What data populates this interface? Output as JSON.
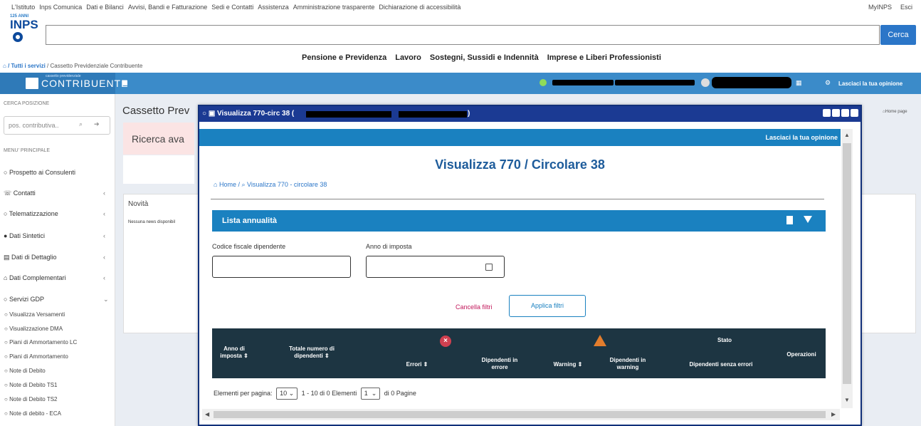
{
  "topnav": {
    "links": [
      "L'Istituto",
      "Inps Comunica",
      "Dati e Bilanci",
      "Avvisi, Bandi e Fatturazione",
      "Sedi e Contatti",
      "Assistenza",
      "Amministrazione trasparente",
      "Dichiarazione di accessibilità"
    ],
    "myinps": "MyINPS",
    "esci": "Esci"
  },
  "logo": {
    "years": "125 ANNI",
    "text": "INPS"
  },
  "search": {
    "button": "Cerca",
    "value": ""
  },
  "mainmenu": [
    "Pensione e Previdenza",
    "Lavoro",
    "Sostegni, Sussidi e Indennità",
    "Imprese e Liberi Professionisti"
  ],
  "breadcrumb": {
    "home": "/ Tutti i servizi",
    "current": "/ Cassetto Previdenziale Contribuente"
  },
  "header": {
    "brand_small": "cassetto previdenziale",
    "brand": "CONTRIBUENTE",
    "opinion": "Lasciaci la tua opinione"
  },
  "sidebar": {
    "cerca_caption": "CERCA POSIZIONE",
    "pos_placeholder": "pos. contributiva..",
    "menu_caption": "MENU' PRINCIPALE",
    "items": [
      {
        "label": "Prospetto ai Consulenti",
        "chevron": ""
      },
      {
        "label": "Contatti",
        "chevron": "‹"
      },
      {
        "label": "Telematizzazione",
        "chevron": "‹"
      },
      {
        "label": "Dati Sintetici",
        "chevron": "‹"
      },
      {
        "label": "Dati di Dettaglio",
        "chevron": "‹"
      },
      {
        "label": "Dati Complementari",
        "chevron": "‹"
      },
      {
        "label": "Servizi GDP",
        "chevron": "⌄"
      }
    ],
    "subitems": [
      "Visualizza Versamenti",
      "Visualizzazione DMA",
      "Piani di Ammortamento LC",
      "Piani di Ammortamento",
      "Note di Debito",
      "Note di Debito TS1",
      "Note di Debito TS2",
      "Note di debito - ECA"
    ]
  },
  "main": {
    "title": "Cassetto Prev",
    "ricerca": "Ricerca ava",
    "novita": "Novità",
    "news": "Nessuna news disponibil",
    "homepage": "Home page"
  },
  "modal": {
    "title": "Visualizza 770-circ 38 (",
    "title_tail": ")",
    "opinion": "Lasciaci la tua opinione",
    "page_title": "Visualizza 770 / Circolare 38",
    "crumb_home": "Home",
    "crumb_current": "Visualizza 770 - circolare 38",
    "list_title": "Lista annualità",
    "filter_cf_label": "Codice fiscale dipendente",
    "filter_anno_label": "Anno di imposta",
    "filter_cf_value": "",
    "filter_anno_value": "",
    "cancella": "Cancella filtri",
    "applica": "Applica filtri",
    "columns": {
      "anno": "Anno di imposta",
      "totale": "Totale numero di dipendenti",
      "errori": "Errori",
      "dip_errore": "Dipendenti in errore",
      "warning": "Warning",
      "dip_warning": "Dipendenti in warning",
      "stato": "Stato",
      "senza_errori": "Dipendenti senza errori",
      "operazioni": "Operazioni"
    },
    "pager": {
      "label": "Elementi per pagina:",
      "per_page": "10",
      "range": "1 - 10 di 0 Elementi",
      "page": "1",
      "pages": "di 0 Pagine"
    }
  },
  "colors": {
    "accent": "#1a81c0",
    "modal_title": "#1b3a93",
    "table_header": "#1d3542",
    "cancel": "#c2185b"
  }
}
